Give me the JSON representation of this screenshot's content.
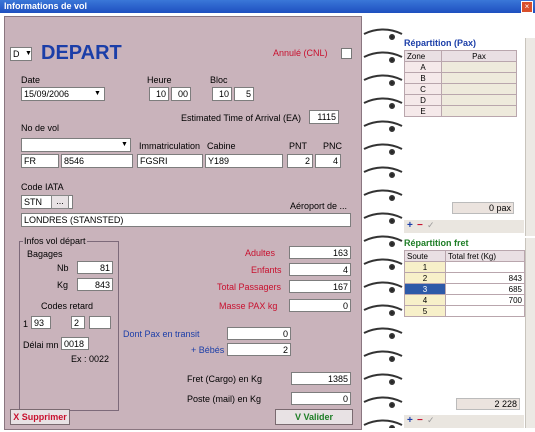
{
  "window": {
    "title": "Informations de vol"
  },
  "flight": {
    "direction_value": "D",
    "direction_title": "DEPART",
    "annule_label": "Annulé (CNL)",
    "date_label": "Date",
    "date_value": "15/09/2006",
    "heure_label": "Heure",
    "heure_h": "10",
    "heure_m": "00",
    "bloc_label": "Bloc",
    "bloc_h": "10",
    "bloc_m": "5",
    "eta_label": "Estimated Time of Arrival (EA)",
    "eta_value": "1115",
    "novol_label": "No de vol",
    "immat_label": "Immatriculation",
    "cabine_label": "Cabine",
    "pnt_label": "PNT",
    "pnc_label": "PNC",
    "airline": "FR",
    "flight_no": "8546",
    "immat": "FGSRI",
    "cabine": "Y189",
    "pnt": "2",
    "pnc": "4",
    "iata_label": "Code IATA",
    "iata_value": "STN",
    "iata_btn": "...",
    "aeroport_label": "Aéroport de ...",
    "airport_name": "LONDRES (STANSTED)"
  },
  "infos": {
    "group_label": "Infos vol départ",
    "bagages_label": "Bagages",
    "nb_label": "Nb",
    "nb_value": "81",
    "kg_label": "Kg",
    "kg_value": "843",
    "codes_label": "Codes retard",
    "code1": "1",
    "code2": "93",
    "code3": "2",
    "code4": "",
    "delai_label": "Délai mn",
    "delai_value": "0018",
    "ex_label": "Ex : 0022"
  },
  "pax": {
    "adultes_label": "Adultes",
    "adultes_value": "163",
    "enfants_label": "Enfants",
    "enfants_value": "4",
    "total_label": "Total Passagers",
    "total_value": "167",
    "masse_label": "Masse PAX kg",
    "masse_value": "0",
    "transit_label": "Dont Pax en transit",
    "transit_value": "0",
    "bebes_label": "+ Bébés",
    "bebes_value": "2",
    "fret_label": "Fret (Cargo) en Kg",
    "fret_value": "1385",
    "poste_label": "Poste (mail) en Kg",
    "poste_value": "0"
  },
  "actions": {
    "supprimer": "X Supprimer",
    "valider": "V Valider"
  },
  "repartition_pax": {
    "title": "Répartition (Pax)",
    "headers": [
      "Zone",
      "Pax"
    ],
    "rows": [
      [
        "A",
        ""
      ],
      [
        "B",
        ""
      ],
      [
        "C",
        ""
      ],
      [
        "D",
        ""
      ],
      [
        "E",
        ""
      ]
    ],
    "total": "0 pax"
  },
  "repartition_fret": {
    "title": "Répartition fret",
    "headers": [
      "Soute",
      "Total fret (Kg)"
    ],
    "rows": [
      [
        "1",
        ""
      ],
      [
        "2",
        "843"
      ],
      [
        "3",
        "685"
      ],
      [
        "4",
        "700"
      ],
      [
        "5",
        ""
      ]
    ],
    "total": "2 228"
  },
  "toolbar": {
    "add": "+",
    "remove": "−",
    "check": "✓"
  },
  "colors": {
    "title_red": "#c8102e",
    "accent_blue": "#1b3ea8",
    "panel": "#c9b3bb",
    "select": "#2d5aa8"
  }
}
